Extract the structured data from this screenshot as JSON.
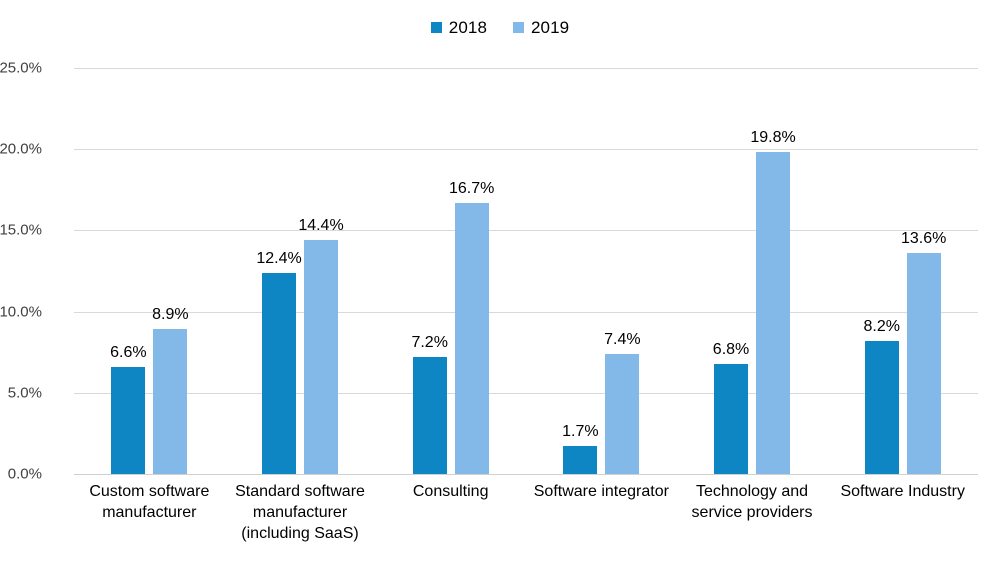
{
  "chart_data": {
    "type": "bar",
    "title": "",
    "subtitle": "",
    "xlabel": "",
    "ylabel": "",
    "categories": [
      "Custom software manufacturer",
      "Standard software manufacturer (including SaaS)",
      "Consulting",
      "Software integrator",
      "Technology and service providers",
      "Software Industry"
    ],
    "category_lines": [
      [
        "Custom software",
        "manufacturer"
      ],
      [
        "Standard software",
        "manufacturer",
        "(including SaaS)"
      ],
      [
        "Consulting"
      ],
      [
        "Software integrator"
      ],
      [
        "Technology and",
        "service providers"
      ],
      [
        "Software Industry"
      ]
    ],
    "series": [
      {
        "name": "2018",
        "color": "#0e86c3",
        "values": [
          6.6,
          12.4,
          7.2,
          1.7,
          6.8,
          8.2
        ],
        "labels": [
          "6.6%",
          "12.4%",
          "7.2%",
          "1.7%",
          "6.8%",
          "8.2%"
        ]
      },
      {
        "name": "2019",
        "color": "#83b9e8",
        "values": [
          8.9,
          14.4,
          16.7,
          7.4,
          19.8,
          13.6
        ],
        "labels": [
          "8.9%",
          "14.4%",
          "16.7%",
          "7.4%",
          "19.8%",
          "13.6%"
        ]
      }
    ],
    "ylim": [
      0,
      25
    ],
    "yticks": [
      0,
      5,
      10,
      15,
      20,
      25
    ],
    "ytick_labels": [
      "0.0%",
      "5.0%",
      "10.0%",
      "15.0%",
      "20.0%",
      "25.0%"
    ],
    "grid": true,
    "grid_color": "#d9d9d9",
    "legend_position": "top-center",
    "value_labels": true,
    "units": "percent",
    "background_color": "#ffffff"
  },
  "legend": {
    "items": [
      {
        "label": "2018",
        "color": "#0e86c3"
      },
      {
        "label": "2019",
        "color": "#83b9e8"
      }
    ]
  }
}
